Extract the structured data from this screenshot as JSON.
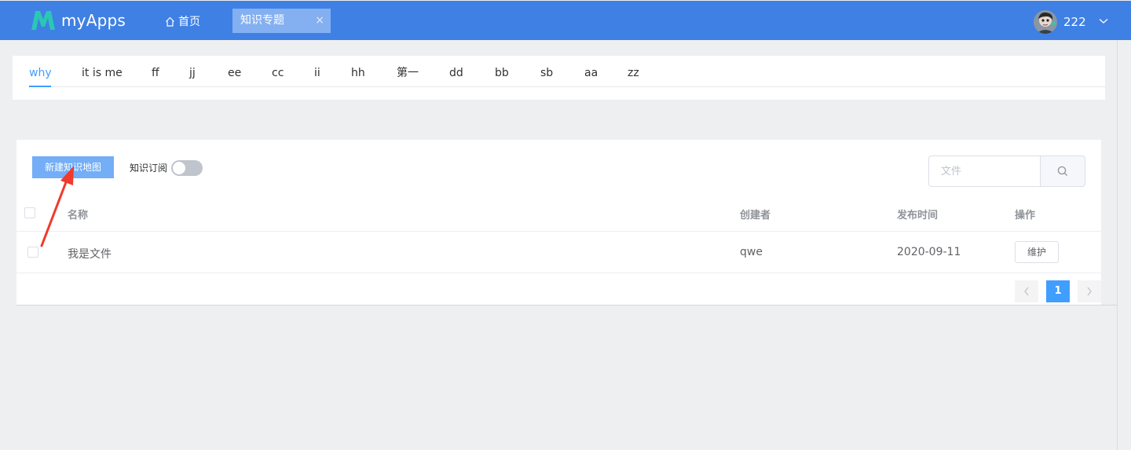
{
  "header": {
    "app_name": "myApps",
    "home_label": "首页",
    "active_tab": {
      "label": "知识专题",
      "close": "×"
    },
    "user": {
      "name": "222"
    },
    "colors": {
      "bar": "#3f80e4",
      "tab": "#84b0f1",
      "logo": "#2bc7b4"
    }
  },
  "categories": {
    "items": [
      "why",
      "it is me",
      "ff",
      "jj",
      "ee",
      "cc",
      "ii",
      "hh",
      "第一",
      "dd",
      "bb",
      "sb",
      "aa",
      "zz"
    ],
    "active_index": 0,
    "active_color": "#409eff"
  },
  "toolbar": {
    "new_button": "新建知识地图",
    "subscribe_label": "知识订阅",
    "subscribe_on": false,
    "search_placeholder": "文件"
  },
  "table": {
    "columns": [
      "名称",
      "创建者",
      "发布时间",
      "操作"
    ],
    "rows": [
      {
        "name": "我是文件",
        "creator": "qwe",
        "date": "2020-09-11",
        "action": "维护"
      }
    ]
  },
  "pagination": {
    "current": "1"
  },
  "annotation": {
    "color": "#f03a2c"
  }
}
